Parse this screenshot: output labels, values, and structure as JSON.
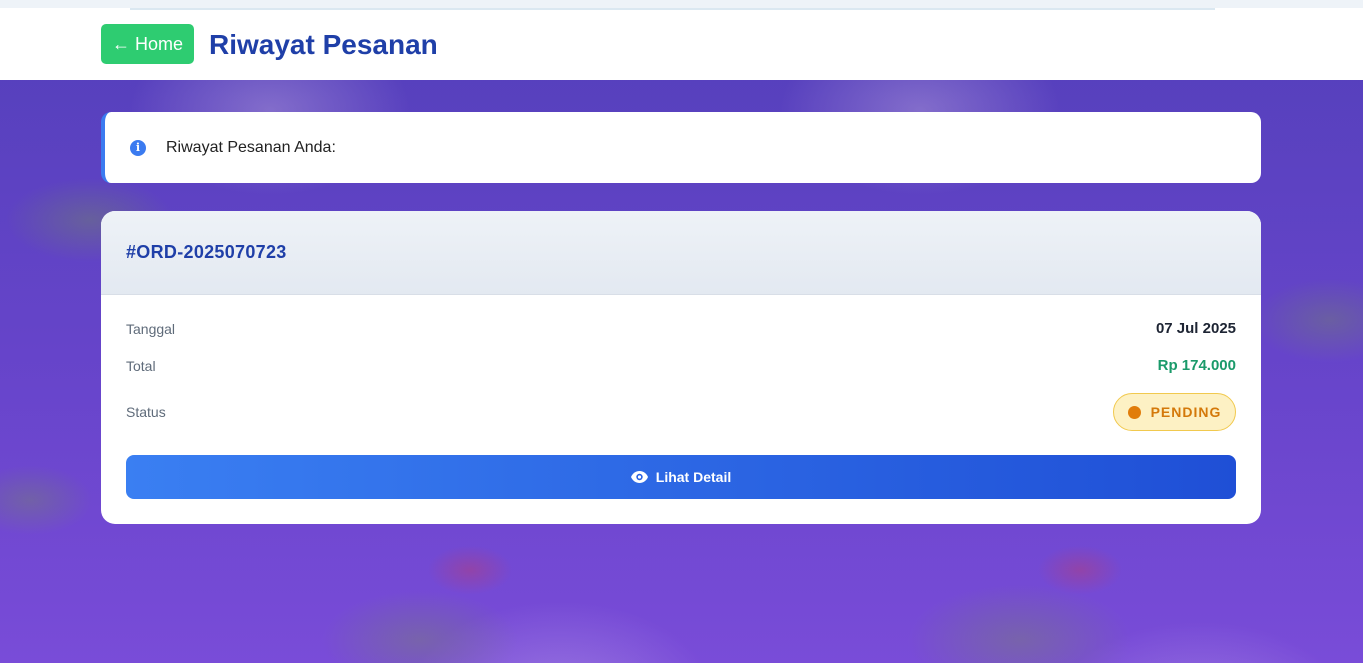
{
  "header": {
    "home_label": "← Home",
    "title": "Riwayat Pesanan"
  },
  "info": {
    "icon": "info-circle-icon",
    "text": "Riwayat Pesanan Anda:"
  },
  "orders": [
    {
      "id": "#ORD-2025070723",
      "date_label": "Tanggal",
      "date_value": "07 Jul 2025",
      "total_label": "Total",
      "total_value": "Rp 174.000",
      "status_label": "Status",
      "status_value": "PENDING",
      "detail_button_label": "Lihat Detail",
      "detail_icon": "eye-icon"
    }
  ],
  "colors": {
    "home_button": "#2ecc71",
    "title": "#1f3fa8",
    "accent_blue": "#3b7bf0",
    "total_green": "#1a9a6a",
    "pending_orange": "#d4790a",
    "pending_bg": "#fdf1c4"
  }
}
